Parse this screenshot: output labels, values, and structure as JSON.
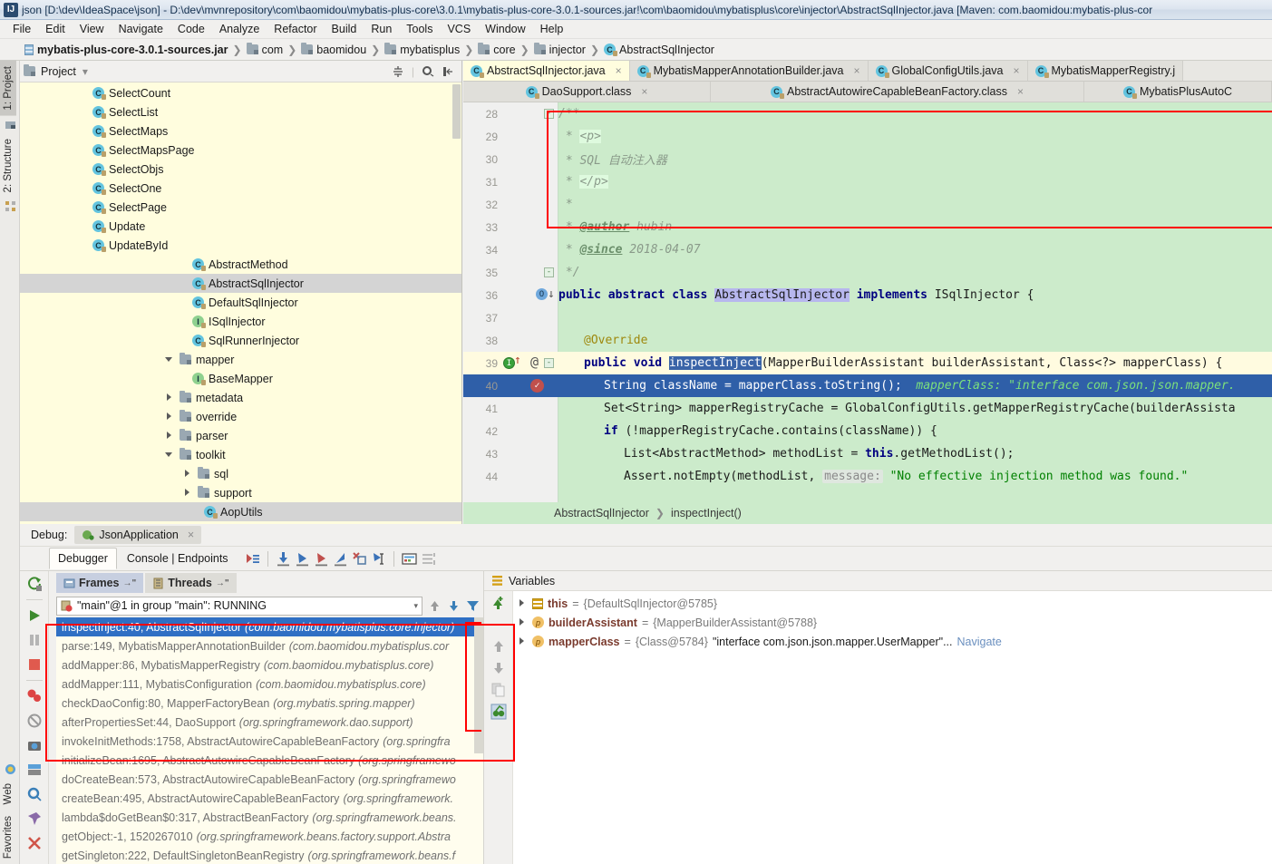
{
  "window": {
    "title": "json [D:\\dev\\IdeaSpace\\json] - D:\\dev\\mvnrepository\\com\\baomidou\\mybatis-plus-core\\3.0.1\\mybatis-plus-core-3.0.1-sources.jar!\\com\\baomidou\\mybatisplus\\core\\injector\\AbstractSqlInjector.java [Maven: com.baomidou:mybatis-plus-cor",
    "logo": "IJ"
  },
  "menu": [
    "File",
    "Edit",
    "View",
    "Navigate",
    "Code",
    "Analyze",
    "Refactor",
    "Build",
    "Run",
    "Tools",
    "VCS",
    "Window",
    "Help"
  ],
  "navbar": [
    {
      "label": "mybatis-plus-core-3.0.1-sources.jar",
      "icon": "jar-icon"
    },
    {
      "label": "com",
      "icon": "folder-icon"
    },
    {
      "label": "baomidou",
      "icon": "folder-icon"
    },
    {
      "label": "mybatisplus",
      "icon": "folder-icon"
    },
    {
      "label": "core",
      "icon": "folder-icon"
    },
    {
      "label": "injector",
      "icon": "folder-icon"
    },
    {
      "label": "AbstractSqlInjector",
      "icon": "class-icon"
    }
  ],
  "left_tool_tabs": {
    "top": [
      "1: Project",
      "2: Structure"
    ],
    "bottom": [
      "Web",
      "Favorites"
    ]
  },
  "project": {
    "title": "Project",
    "tree": [
      {
        "label": "SelectCount",
        "icon": "class-icon",
        "indent": 4,
        "twist": "none"
      },
      {
        "label": "SelectList",
        "icon": "class-icon",
        "indent": 4,
        "twist": "none"
      },
      {
        "label": "SelectMaps",
        "icon": "class-icon",
        "indent": 4,
        "twist": "none"
      },
      {
        "label": "SelectMapsPage",
        "icon": "class-icon",
        "indent": 4,
        "twist": "none"
      },
      {
        "label": "SelectObjs",
        "icon": "class-icon",
        "indent": 4,
        "twist": "none"
      },
      {
        "label": "SelectOne",
        "icon": "class-icon",
        "indent": 4,
        "twist": "none"
      },
      {
        "label": "SelectPage",
        "icon": "class-icon",
        "indent": 4,
        "twist": "none"
      },
      {
        "label": "Update",
        "icon": "class-icon",
        "indent": 4,
        "twist": "none"
      },
      {
        "label": "UpdateById",
        "icon": "class-icon",
        "indent": 4,
        "twist": "none"
      },
      {
        "label": "AbstractMethod",
        "icon": "class-icon",
        "indent": 3,
        "twist": "none"
      },
      {
        "label": "AbstractSqlInjector",
        "icon": "class-icon",
        "indent": 3,
        "twist": "none",
        "selected": true
      },
      {
        "label": "DefaultSqlInjector",
        "icon": "class-icon",
        "indent": 3,
        "twist": "none"
      },
      {
        "label": "ISqlInjector",
        "icon": "interface-icon",
        "indent": 3,
        "twist": "none"
      },
      {
        "label": "SqlRunnerInjector",
        "icon": "class-icon",
        "indent": 3,
        "twist": "none"
      },
      {
        "label": "mapper",
        "icon": "folder-icon",
        "indent": 2,
        "twist": "open"
      },
      {
        "label": "BaseMapper",
        "icon": "interface-icon",
        "indent": 3,
        "twist": "none"
      },
      {
        "label": "metadata",
        "icon": "folder-icon",
        "indent": 2,
        "twist": "closed"
      },
      {
        "label": "override",
        "icon": "folder-icon",
        "indent": 2,
        "twist": "closed"
      },
      {
        "label": "parser",
        "icon": "folder-icon",
        "indent": 2,
        "twist": "closed"
      },
      {
        "label": "toolkit",
        "icon": "folder-icon",
        "indent": 2,
        "twist": "open"
      },
      {
        "label": "sql",
        "icon": "folder-icon",
        "indent": 3,
        "twist": "closed"
      },
      {
        "label": "support",
        "icon": "folder-icon",
        "indent": 3,
        "twist": "closed"
      },
      {
        "label": "AopUtils",
        "icon": "class-icon",
        "indent": 3,
        "twist": "none",
        "selected": true
      }
    ]
  },
  "editor": {
    "tabs_row1": [
      {
        "label": "AbstractSqlInjector.java",
        "icon": "class-icon",
        "active": true,
        "close": "×"
      },
      {
        "label": "MybatisMapperAnnotationBuilder.java",
        "icon": "class-icon",
        "active": false,
        "close": "×"
      },
      {
        "label": "GlobalConfigUtils.java",
        "icon": "class-icon",
        "active": false,
        "close": "×"
      },
      {
        "label": "MybatisMapperRegistry.j",
        "icon": "class-icon",
        "active": false,
        "close": ""
      }
    ],
    "tabs_row2": [
      {
        "label": "DaoSupport.class",
        "icon": "class-icon",
        "active": false,
        "close": "×"
      },
      {
        "label": "AbstractAutowireCapableBeanFactory.class",
        "icon": "class-icon",
        "active": false,
        "close": "×"
      },
      {
        "label": "MybatisPlusAutoC",
        "icon": "class-icon",
        "active": false,
        "close": ""
      }
    ],
    "breadcrumb": [
      "AbstractSqlInjector",
      "inspectInject()"
    ],
    "lines": [
      {
        "num": "28",
        "indent": 0
      },
      {
        "num": "29",
        "indent": 0
      },
      {
        "num": "30",
        "indent": 0
      },
      {
        "num": "31",
        "indent": 0
      },
      {
        "num": "32",
        "indent": 0
      },
      {
        "num": "33",
        "indent": 0
      },
      {
        "num": "34",
        "indent": 0
      },
      {
        "num": "35",
        "indent": 0
      },
      {
        "num": "36",
        "indent": 0
      },
      {
        "num": "37",
        "indent": 0
      },
      {
        "num": "38",
        "indent": 0
      },
      {
        "num": "39",
        "indent": 0
      },
      {
        "num": "40",
        "indent": 0
      },
      {
        "num": "41",
        "indent": 0
      },
      {
        "num": "42",
        "indent": 0
      },
      {
        "num": "43",
        "indent": 0
      },
      {
        "num": "44",
        "indent": 0
      }
    ],
    "code": {
      "l28": "/**",
      "l29_star": " * ",
      "l29_tag": "<p>",
      "l30": " * SQL 自动注入器",
      "l31_star": " * ",
      "l31_tag": "</p>",
      "l32": " *",
      "l33_star": " * ",
      "l33_tag": "@author",
      "l33_val": " hubin",
      "l34_tag": "@since",
      "l34_val": " 2018-04-07",
      "l35": " */",
      "l36_kw1": "public abstract class ",
      "l36_name": "AbstractSqlInjector",
      "l36_kw2": " implements ",
      "l36_iface": "ISqlInjector {",
      "l38": "@Override",
      "l39_kw": "public void ",
      "l39_name": "inspectInject",
      "l39_rest": "(MapperBuilderAssistant builderAssistant, Class<?> mapperClass) {",
      "l40_code": "String className = mapperClass.toString();",
      "l40_hint": "mapperClass:",
      "l40_str": " \"interface com.json.json.mapper.",
      "l41": "Set<String> mapperRegistryCache = GlobalConfigUtils.getMapperRegistryCache(builderAssista",
      "l42_kw": "if",
      "l42_rest": " (!mapperRegistryCache.contains(className)) {",
      "l43_a": "List<AbstractMethod> methodList = ",
      "l43_this": "this",
      "l43_b": ".getMethodList();",
      "l44_a": "Assert.notEmpty(methodList, ",
      "l44_hint": "message:",
      "l44_str": " \"No effective injection method was found.\""
    }
  },
  "debug": {
    "label": "Debug:",
    "config_name": "JsonApplication",
    "close": "×",
    "tabs": [
      {
        "label": "Debugger",
        "active": true
      },
      {
        "label": "Console | Endpoints",
        "active": false
      }
    ],
    "toolbar_icons": [
      "show-execution-point-icon",
      "step-over-icon",
      "step-into-icon",
      "force-step-into-icon",
      "step-out-icon",
      "drop-frame-icon",
      "run-to-cursor-icon",
      "evaluate-expression-icon",
      "layout-icon"
    ],
    "rail_icons": [
      "rerun-icon",
      "resume-icon",
      "pause-icon",
      "stop-icon",
      "view-breakpoints-icon",
      "mute-breakpoints-icon",
      "settings-camera-icon",
      "restore-layout-icon",
      "settings-gear-icon",
      "pin-icon",
      "close-icon"
    ],
    "frames": {
      "tab_frames": "Frames",
      "tab_threads": "Threads",
      "thread_selector": "\"main\"@1 in group \"main\": RUNNING",
      "items": [
        {
          "method": "inspectInject:40, AbstractSqlInjector",
          "pkg": "(com.baomidou.mybatisplus.core.injector)",
          "selected": true
        },
        {
          "method": "parse:149, MybatisMapperAnnotationBuilder",
          "pkg": "(com.baomidou.mybatisplus.cor",
          "selected": false
        },
        {
          "method": "addMapper:86, MybatisMapperRegistry",
          "pkg": "(com.baomidou.mybatisplus.core)",
          "selected": false
        },
        {
          "method": "addMapper:111, MybatisConfiguration",
          "pkg": "(com.baomidou.mybatisplus.core)",
          "selected": false
        },
        {
          "method": "checkDaoConfig:80, MapperFactoryBean",
          "pkg": "(org.mybatis.spring.mapper)",
          "selected": false
        },
        {
          "method": "afterPropertiesSet:44, DaoSupport",
          "pkg": "(org.springframework.dao.support)",
          "selected": false
        },
        {
          "method": "invokeInitMethods:1758, AbstractAutowireCapableBeanFactory",
          "pkg": "(org.springfra",
          "selected": false
        },
        {
          "method": "initializeBean:1695, AbstractAutowireCapableBeanFactory",
          "pkg": "(org.springframewo",
          "selected": false
        },
        {
          "method": "doCreateBean:573, AbstractAutowireCapableBeanFactory",
          "pkg": "(org.springframewo",
          "selected": false
        },
        {
          "method": "createBean:495, AbstractAutowireCapableBeanFactory",
          "pkg": "(org.springframework.",
          "selected": false
        },
        {
          "method": "lambda$doGetBean$0:317, AbstractBeanFactory",
          "pkg": "(org.springframework.beans.",
          "selected": false
        },
        {
          "method": "getObject:-1, 1520267010",
          "pkg": "(org.springframework.beans.factory.support.Abstra",
          "selected": false
        },
        {
          "method": "getSingleton:222, DefaultSingletonBeanRegistry",
          "pkg": "(org.springframework.beans.f",
          "selected": false
        }
      ]
    },
    "variables": {
      "title": "Variables",
      "rail_icons": [
        "add-watch-icon",
        "remove-icon",
        "move-up-icon",
        "move-down-icon",
        "copy-icon",
        "inspect-icon"
      ],
      "rows": [
        {
          "name": "this",
          "icon": "object-icon",
          "eq": " = ",
          "value": "{DefaultSqlInjector@5785}",
          "string": "",
          "link": ""
        },
        {
          "name": "builderAssistant",
          "icon": "param-icon",
          "eq": " = ",
          "value": "{MapperBuilderAssistant@5788}",
          "string": "",
          "link": ""
        },
        {
          "name": "mapperClass",
          "icon": "param-icon",
          "eq": " = ",
          "value": "{Class@5784}",
          "string": "\"interface com.json.json.mapper.UserMapper\"...",
          "link": "Navigate"
        }
      ]
    }
  },
  "colors": {
    "editor_highlight": "#ccebcb",
    "selection": "#2f5fa8",
    "annotation_red": "#ff0000",
    "tree_bg": "#fffdde"
  }
}
